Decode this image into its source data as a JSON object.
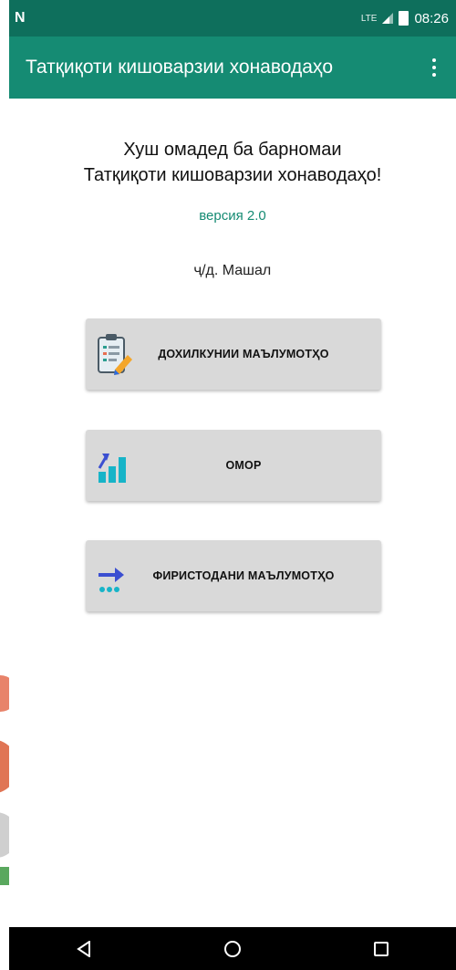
{
  "status_bar": {
    "left_icon": "N",
    "network": "LTE",
    "time": "08:26"
  },
  "app_bar": {
    "title": "Татқиқоти кишоварзии хонаводаҳо",
    "overflow_icon": "more-vert-icon"
  },
  "welcome": {
    "line1": "Хуш омадед ба барномаи",
    "line2": "Татқиқоти кишоварзии хонаводаҳо!"
  },
  "version": "версия 2.0",
  "author": "ҷ/д. Машал",
  "buttons": [
    {
      "label": "ДОХИЛКУНИИ МАЪЛУМОТҲО",
      "icon": "clipboard-pencil-icon"
    },
    {
      "label": "ОМОР",
      "icon": "bar-chart-icon"
    },
    {
      "label": "ФИРИСТОДАНИ МАЪЛУМОТҲО",
      "icon": "send-data-icon"
    }
  ],
  "nav": {
    "back_icon": "back-triangle-icon",
    "home_icon": "home-circle-icon",
    "recents_icon": "recents-square-icon"
  },
  "colors": {
    "status_bar": "#0e6f5c",
    "app_bar": "#158b73",
    "accent_text": "#158b73",
    "button_bg": "#d9d9d9"
  }
}
